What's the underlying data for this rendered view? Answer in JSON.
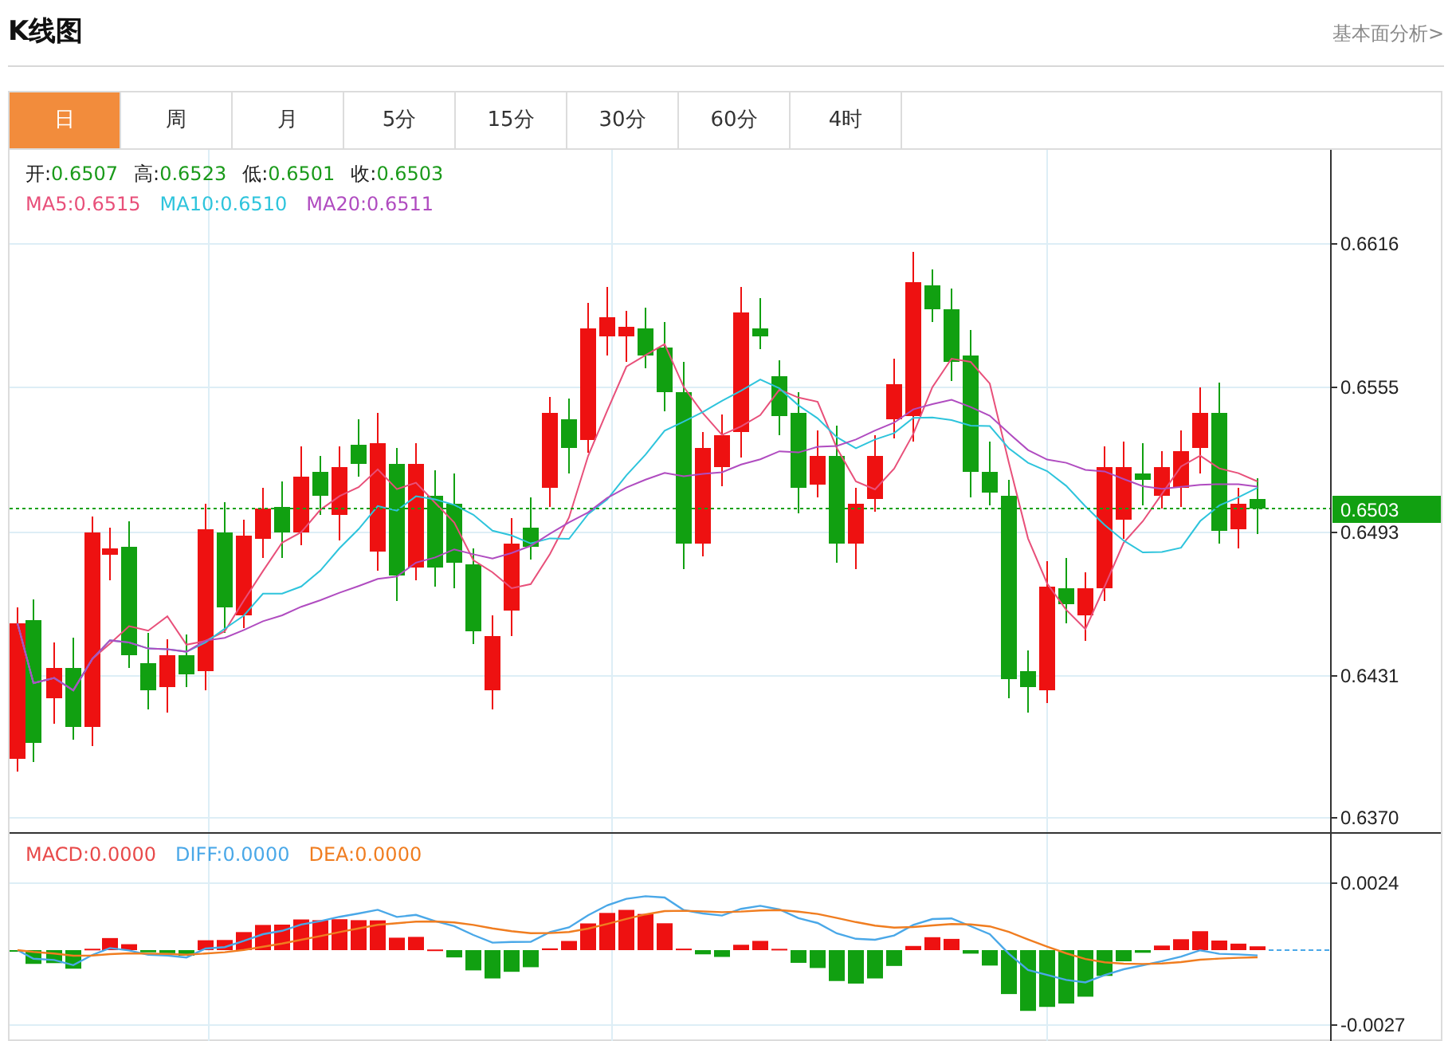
{
  "header": {
    "title": "K线图",
    "link": "基本面分析>"
  },
  "tabs": [
    {
      "label": "日",
      "selected": true
    },
    {
      "label": "周",
      "selected": false
    },
    {
      "label": "月",
      "selected": false
    },
    {
      "label": "5分",
      "selected": false
    },
    {
      "label": "15分",
      "selected": false
    },
    {
      "label": "30分",
      "selected": false
    },
    {
      "label": "60分",
      "selected": false
    },
    {
      "label": "4时",
      "selected": false
    }
  ],
  "price_chart": {
    "ohlc": [
      {
        "label": "开:",
        "value": "0.6507"
      },
      {
        "label": "高:",
        "value": "0.6523"
      },
      {
        "label": "低:",
        "value": "0.6501"
      },
      {
        "label": "收:",
        "value": "0.6503"
      }
    ],
    "moving_averages": [
      {
        "label": "MA5:",
        "value": "0.6515",
        "color": "#e8507a"
      },
      {
        "label": "MA10:",
        "value": "0.6510",
        "color": "#2ec4dc"
      },
      {
        "label": "MA20:",
        "value": "0.6511",
        "color": "#b04cc0"
      }
    ],
    "y_labels": [
      "0.6616",
      "0.6555",
      "0.6493",
      "0.6431",
      "0.6370"
    ],
    "current_price": "0.6503"
  },
  "macd_chart": {
    "legend": [
      {
        "label": "MACD:",
        "value": "0.0000",
        "color": "#e84a4a"
      },
      {
        "label": "DIFF:",
        "value": "0.0000",
        "color": "#4aa8e8"
      },
      {
        "label": "DEA:",
        "value": "0.0000",
        "color": "#f07d20"
      }
    ],
    "y_labels": [
      "0.0024",
      "-0.0027"
    ]
  }
}
